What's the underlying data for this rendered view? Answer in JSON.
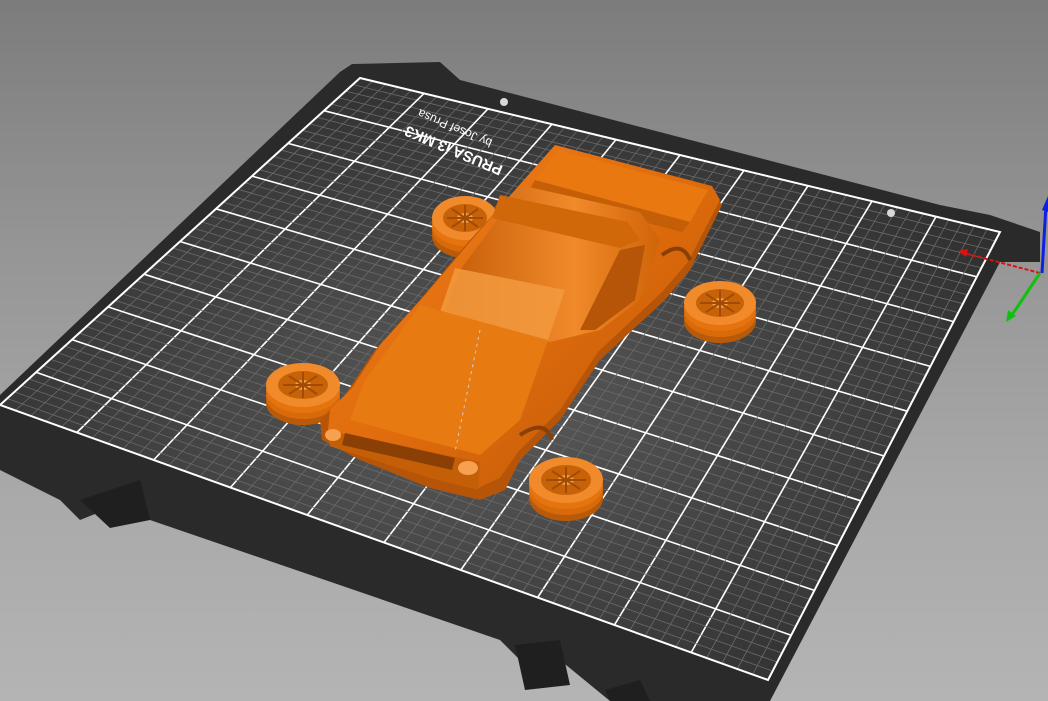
{
  "app": {
    "view": "3D plater view"
  },
  "bed": {
    "printer_label": "PRUSA i3 MK3",
    "author_label": "by Josef Prusa"
  },
  "colors": {
    "background_top": "#7c7c7c",
    "background_bottom": "#b4b4b4",
    "bed_plate": "#2b2b2b",
    "bed_surface": "#3a3a3a",
    "grid_minor": "#6e6e6e",
    "grid_major": "#ffffff",
    "model_orange": "#e66f0d",
    "axis_x": "#e01010",
    "axis_y": "#10c010",
    "axis_z": "#1020e0"
  },
  "objects": [
    {
      "name": "car-body",
      "type": "model"
    },
    {
      "name": "wheel-1",
      "type": "model"
    },
    {
      "name": "wheel-2",
      "type": "model"
    },
    {
      "name": "wheel-3",
      "type": "model"
    },
    {
      "name": "wheel-4",
      "type": "model"
    }
  ],
  "axes": {
    "x_icon": "x-axis-arrow",
    "y_icon": "y-axis-arrow",
    "z_icon": "z-axis-arrow"
  }
}
